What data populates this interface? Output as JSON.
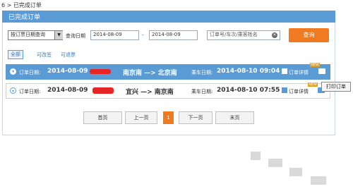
{
  "breadcrumb": "6 > 已完成订单",
  "panel": {
    "title": "已完成订单"
  },
  "search": {
    "query_type": "按订票日期查询",
    "date_label": "查询日期",
    "start_date": "2014-08-09",
    "separator": "-",
    "end_date": "2014-08-09",
    "keyword_placeholder": "订单号/车次/乘客姓名",
    "query_button": "查询"
  },
  "filter_tabs": [
    "全部",
    "可改签",
    "可退票"
  ],
  "orders": [
    {
      "order_date_label": "订单日期:",
      "order_date": "2014-08-09",
      "route": "南京南 —> 北京南",
      "depart_label": "乘车日期:",
      "depart_time": "2014-08-10 09:04",
      "detail_label": "订单详情",
      "new_badge": "NEW",
      "expanded": true
    },
    {
      "order_date_label": "订单日期:",
      "order_date": "2014-08-09",
      "route": "宜兴 —> 南京南",
      "depart_label": "乘车日期:",
      "depart_time": "2014-08-10 07:55",
      "detail_label": "订单详情",
      "new_badge": "NEW",
      "expanded": false
    }
  ],
  "tooltip": "打印订单",
  "pagination": {
    "first": "首页",
    "prev": "上一页",
    "current": "1",
    "next": "下一页",
    "last": "末页"
  },
  "colors": {
    "header_blue": "#5b9bd5",
    "accent_orange": "#f07a1f",
    "redaction_red": "#e82525"
  },
  "icons": {
    "toggle": "chevron-circle-icon",
    "details": "clipboard-icon",
    "print": "printer-icon",
    "clear": "clear-x-icon"
  }
}
